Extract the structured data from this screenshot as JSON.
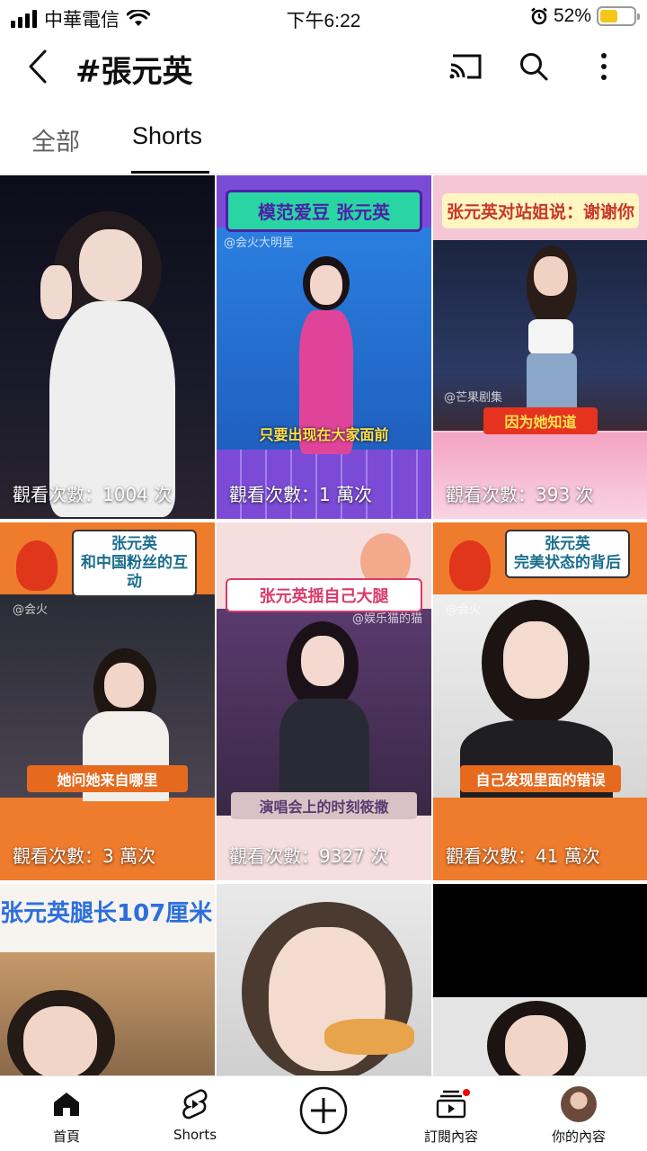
{
  "status_bar": {
    "carrier": "中華電信",
    "time": "下午6:22",
    "battery_percent": "52%",
    "battery_level": 0.52
  },
  "header": {
    "title": "#張元英"
  },
  "tabs": [
    {
      "label": "全部",
      "active": false
    },
    {
      "label": "Shorts",
      "active": true
    }
  ],
  "videos": [
    {
      "views": "觀看次數：1004 次"
    },
    {
      "views": "觀看次數：1 萬次",
      "banner": "模范爱豆 张元英",
      "caption": "只要出现在大家面前",
      "watermark": "@会火大明星"
    },
    {
      "views": "觀看次數：393 次",
      "banner": "张元英对站姐说：谢谢你",
      "caption": "因为她知道",
      "watermark": "@芒果剧集"
    },
    {
      "views": "觀看次數：3 萬次",
      "banner_line1": "张元英",
      "banner_line2": "和中国粉丝的互动",
      "caption": "她问她来自哪里",
      "watermark": "@会火"
    },
    {
      "views": "觀看次數：9327 次",
      "banner": "张元英揺自己大腿",
      "caption": "演唱会上的时刻筱撒",
      "watermark": "@娱乐猫的猫"
    },
    {
      "views": "觀看次數：41 萬次",
      "banner_line1": "张元英",
      "banner_line2": "完美状态的背后",
      "caption": "自己发现里面的错误",
      "watermark": "@会火"
    },
    {
      "banner": "张元英腿长107厘米"
    },
    {},
    {}
  ],
  "bottom_nav": [
    {
      "label": "首頁",
      "icon": "home-icon"
    },
    {
      "label": "Shorts",
      "icon": "shorts-icon"
    },
    {
      "label": "",
      "icon": "create-icon"
    },
    {
      "label": "訂閱內容",
      "icon": "subscriptions-icon"
    },
    {
      "label": "你的內容",
      "icon": "avatar"
    }
  ]
}
